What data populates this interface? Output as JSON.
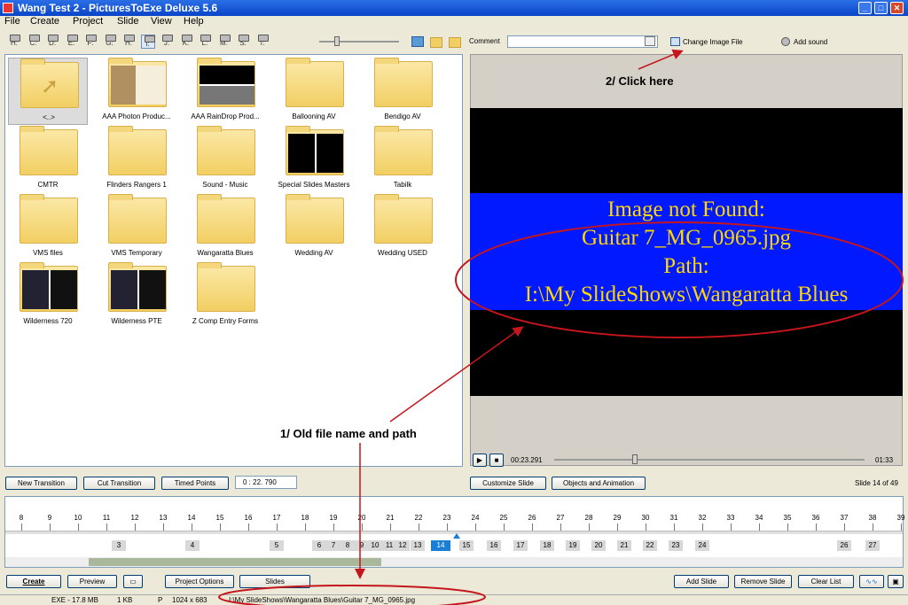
{
  "window": {
    "title": "Wang Test 2 - PicturesToExe Deluxe 5.6"
  },
  "menu": [
    "File",
    "Create",
    "Project",
    "Slide",
    "View",
    "Help"
  ],
  "drive_buttons": [
    "H:",
    "C:",
    "D:",
    "E:",
    "F:",
    "G:",
    "H:",
    "I:",
    "J:",
    "K:",
    "L:",
    "M:",
    "S:",
    "T:"
  ],
  "toolbar": {
    "comment_label": "Comment",
    "change_image_label": "Change Image File",
    "add_sound_label": "Add sound"
  },
  "folders": [
    {
      "label": "<..>",
      "kind": "up",
      "selected": true
    },
    {
      "label": "AAA Photon Produc...",
      "kind": "thumb1"
    },
    {
      "label": "AAA RainDrop Prod...",
      "kind": "thumb2"
    },
    {
      "label": "Ballooning AV",
      "kind": "folder"
    },
    {
      "label": "Bendigo AV",
      "kind": "folder"
    },
    {
      "label": "CMTR",
      "kind": "folder"
    },
    {
      "label": "Flinders Rangers 1",
      "kind": "folder"
    },
    {
      "label": "Sound - Music",
      "kind": "folder"
    },
    {
      "label": "Special Slides Masters",
      "kind": "thumb3"
    },
    {
      "label": "Tabilk",
      "kind": "folder"
    },
    {
      "label": "VMS files",
      "kind": "folder"
    },
    {
      "label": "VMS Temporary",
      "kind": "folder"
    },
    {
      "label": "Wangaratta Blues",
      "kind": "folder"
    },
    {
      "label": "Wedding AV",
      "kind": "folder"
    },
    {
      "label": "Wedding USED",
      "kind": "folder"
    },
    {
      "label": "Wilderness 720",
      "kind": "thumb4"
    },
    {
      "label": "Wilderness PTE",
      "kind": "thumb4"
    },
    {
      "label": "Z Comp Entry Forms",
      "kind": "folder"
    }
  ],
  "preview": {
    "lines": [
      "Image not Found:",
      "Guitar 7_MG_0965.jpg",
      "Path:",
      "I:\\My SlideShows\\Wangaratta Blues"
    ],
    "time_current": "00:23.291",
    "time_total": "01:33",
    "slider_fraction": 0.25
  },
  "annotations": {
    "click_here": "2/ Click here",
    "old_file": "1/ Old file name and path"
  },
  "controls": {
    "new_transition": "New Transition",
    "cut_transition": "Cut Transition",
    "timed_points": "Timed Points",
    "time_value": "0 : 22. 790",
    "customize_slide": "Customize Slide",
    "objects_animation": "Objects and Animation",
    "slide_counter": "Slide 14 of 49"
  },
  "timeline": {
    "ruler": [
      "8",
      "9",
      "10",
      "11",
      "12",
      "13",
      "14",
      "15",
      "16",
      "17",
      "18",
      "19",
      "20",
      "21",
      "22",
      "23",
      "24",
      "25",
      "26",
      "27",
      "28",
      "29",
      "30",
      "31",
      "32",
      "33",
      "34",
      "35",
      "36",
      "37",
      "38",
      "39"
    ],
    "slides": [
      "3",
      "4",
      "5",
      "6",
      "7",
      "8",
      "9",
      "10",
      "11",
      "12",
      "13",
      "14",
      "15",
      "16",
      "17",
      "18",
      "19",
      "20",
      "21",
      "22",
      "23",
      "24",
      "26",
      "27"
    ],
    "current_slide": "14"
  },
  "bottom": {
    "create": "Create",
    "preview": "Preview",
    "project_options": "Project Options",
    "slides": "Slides",
    "add_slide": "Add Slide",
    "remove_slide": "Remove Slide",
    "clear_list": "Clear List"
  },
  "status": {
    "exe": "EXE - 17.8 MB",
    "kb": "1 KB",
    "p": "P",
    "dims": "1024 x 683",
    "path": "I:\\My SlideShows\\Wangaratta Blues\\Guitar 7_MG_0965.jpg"
  },
  "colors": {
    "preview_band": "#0019ff",
    "preview_text": "#ffd700",
    "annotation_red": "#c4161c",
    "current_slide": "#1a7fd4"
  }
}
